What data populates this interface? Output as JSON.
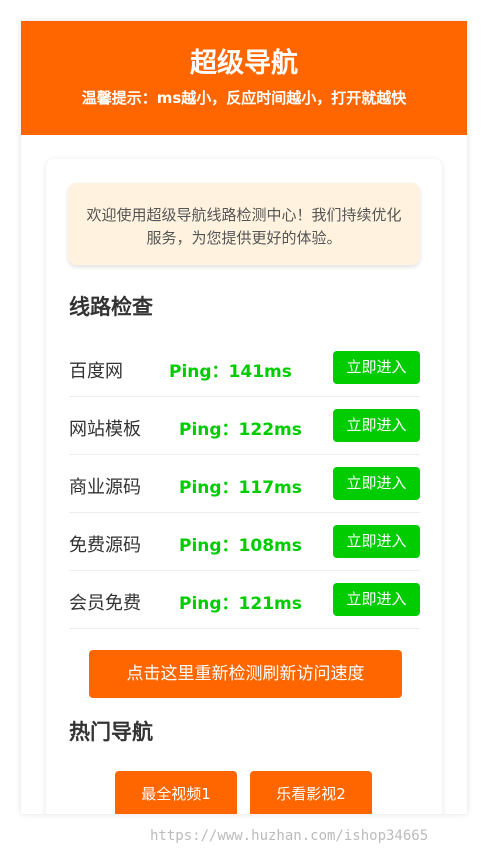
{
  "header": {
    "title": "超级导航",
    "tip": "温馨提示：ms越小，反应时间越小，打开就越快"
  },
  "notice": {
    "text": "欢迎使用超级导航线路检测中心！我们持续优化服务，为您提供更好的体验。"
  },
  "check": {
    "title": "线路检查",
    "enter_label": "立即进入",
    "rows": [
      {
        "name": "百度网",
        "ping": "Ping：141ms"
      },
      {
        "name": "网站模板",
        "ping": "Ping：122ms"
      },
      {
        "name": "商业源码",
        "ping": "Ping：117ms"
      },
      {
        "name": "免费源码",
        "ping": "Ping：108ms"
      },
      {
        "name": "会员免费",
        "ping": "Ping：121ms"
      }
    ]
  },
  "recheck_label": "点击这里重新检测刷新访问速度",
  "hot": {
    "title": "热门导航",
    "items": [
      "最全视频1",
      "乐看影视2"
    ]
  },
  "watermark": "https://www.huzhan.com/ishop34665",
  "colors": {
    "accent": "#ff6600",
    "success": "#00cc00",
    "notice_bg": "#fff3e0"
  }
}
